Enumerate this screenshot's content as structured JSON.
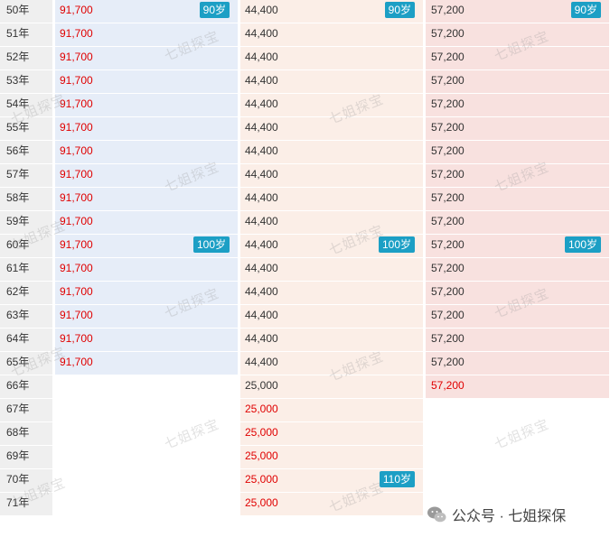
{
  "years": [
    "50年",
    "51年",
    "52年",
    "53年",
    "54年",
    "55年",
    "56年",
    "57年",
    "58年",
    "59年",
    "60年",
    "61年",
    "62年",
    "63年",
    "64年",
    "65年",
    "66年",
    "67年",
    "68年",
    "69年",
    "70年",
    "71年"
  ],
  "col1": [
    "91,700",
    "91,700",
    "91,700",
    "91,700",
    "91,700",
    "91,700",
    "91,700",
    "91,700",
    "91,700",
    "91,700",
    "91,700",
    "91,700",
    "91,700",
    "91,700",
    "91,700",
    "91,700"
  ],
  "col2": [
    "44,400",
    "44,400",
    "44,400",
    "44,400",
    "44,400",
    "44,400",
    "44,400",
    "44,400",
    "44,400",
    "44,400",
    "44,400",
    "44,400",
    "44,400",
    "44,400",
    "44,400",
    "44,400",
    "25,000",
    "25,000",
    "25,000",
    "25,000",
    "25,000",
    "25,000"
  ],
  "col3": [
    "57,200",
    "57,200",
    "57,200",
    "57,200",
    "57,200",
    "57,200",
    "57,200",
    "57,200",
    "57,200",
    "57,200",
    "57,200",
    "57,200",
    "57,200",
    "57,200",
    "57,200",
    "57,200",
    "57,200"
  ],
  "badges": {
    "age90": "90岁",
    "age100": "100岁",
    "age110": "110岁"
  },
  "watermark": "七姐探宝",
  "footer": {
    "prefix": "公众号 · 七姐探保"
  },
  "colors": {
    "red_value": "#e00000",
    "badge": "#1c9fc5",
    "col1_bg": "#e6edf8",
    "col2_bg": "#fbeee7",
    "col3_bg": "#f8e1df"
  }
}
